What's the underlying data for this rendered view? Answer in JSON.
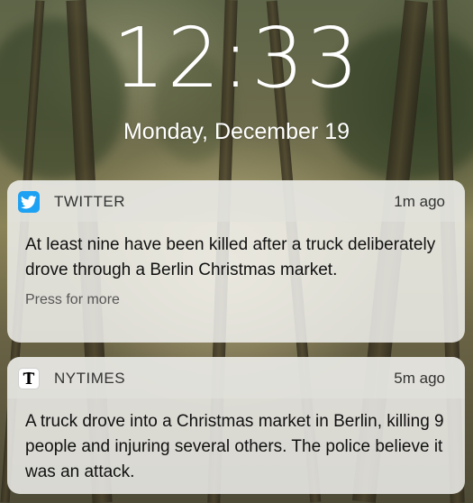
{
  "lockscreen": {
    "time": "12:33",
    "date": "Monday, December 19"
  },
  "notifications": [
    {
      "app": "TWITTER",
      "icon": "twitter-bird-icon",
      "icon_color": "#1DA1F2",
      "time": "1m ago",
      "message": "At least nine have been killed after a truck deliberately drove through a Berlin Christmas market.",
      "action": "Press for more"
    },
    {
      "app": "NYTIMES",
      "icon": "nytimes-t-icon",
      "icon_color": "#ffffff",
      "time": "5m ago",
      "message": "A truck drove into a Christmas market in Berlin, killing 9 people and injuring several others. The police believe it was an attack."
    }
  ]
}
